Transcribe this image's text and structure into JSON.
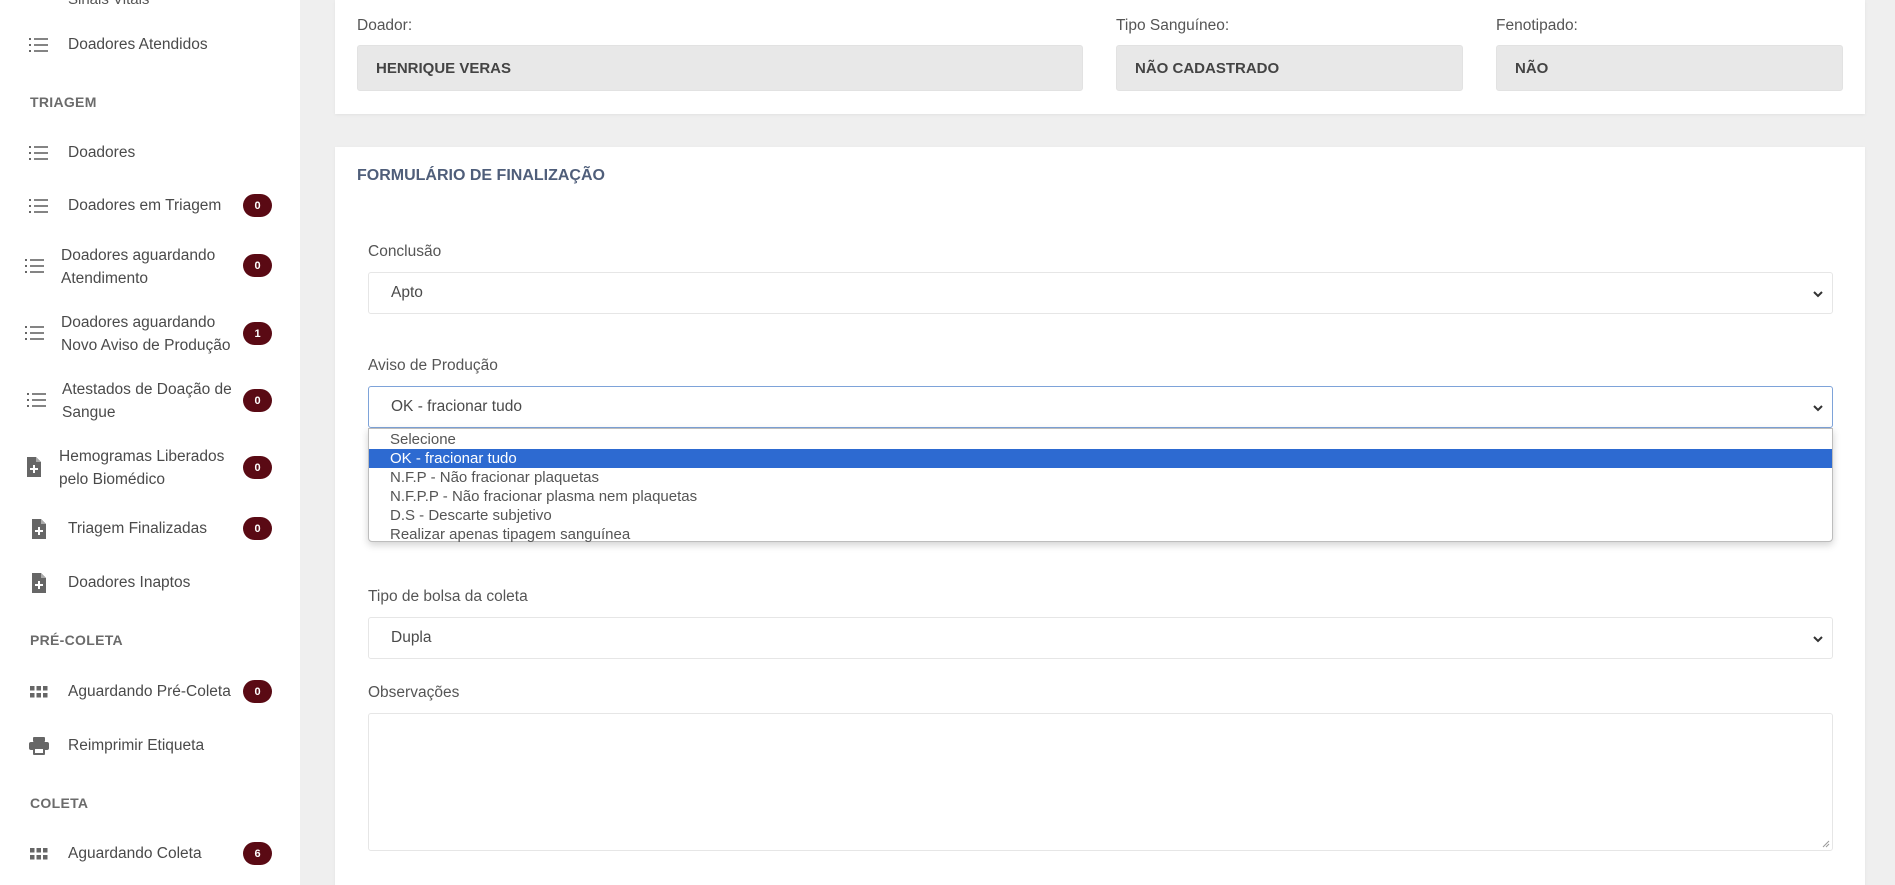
{
  "sidebar": {
    "cut_item": "Sinais Vitais",
    "sections": {
      "triagem": "TRIAGEM",
      "pre_coleta": "PRÉ-COLETA",
      "coleta": "COLETA"
    },
    "items": {
      "doadores_atendidos": {
        "label": "Doadores Atendidos",
        "icon": "list-icon"
      },
      "doadores": {
        "label": "Doadores",
        "icon": "list-icon"
      },
      "doadores_em_triagem": {
        "label": "Doadores em Triagem",
        "badge": "0",
        "icon": "list-icon"
      },
      "aguardando_atendimento": {
        "label1": "Doadores aguardando",
        "label2": "Atendimento",
        "badge": "0",
        "icon": "list-icon"
      },
      "aguardando_aviso": {
        "label1": "Doadores aguardando",
        "label2": "Novo Aviso de Produção",
        "badge": "1",
        "icon": "list-icon"
      },
      "atestados": {
        "label1": "Atestados de Doação de",
        "label2": "Sangue",
        "badge": "0",
        "icon": "list-icon"
      },
      "hemogramas": {
        "label1": "Hemogramas Liberados",
        "label2": "pelo Biomédico",
        "badge": "0",
        "icon": "file-plus-icon"
      },
      "triagem_finalizadas": {
        "label": "Triagem Finalizadas",
        "badge": "0",
        "icon": "file-plus-icon"
      },
      "doadores_inaptos": {
        "label": "Doadores Inaptos",
        "icon": "file-plus-icon"
      },
      "aguardando_pre_coleta": {
        "label": "Aguardando Pré-Coleta",
        "badge": "0",
        "icon": "grid-icon"
      },
      "reimprimir_etiqueta": {
        "label": "Reimprimir Etiqueta",
        "icon": "printer-icon"
      },
      "aguardando_coleta": {
        "label": "Aguardando Coleta",
        "badge": "6",
        "icon": "grid-icon"
      }
    },
    "badge_color": "#5a0a14"
  },
  "donor": {
    "doador_label": "Doador:",
    "doador_value": "HENRIQUE VERAS",
    "tipo_label": "Tipo Sanguíneo:",
    "tipo_value": "NÃO CADASTRADO",
    "fenotipado_label": "Fenotipado:",
    "fenotipado_value": "NÃO"
  },
  "form": {
    "title": "FORMULÁRIO DE FINALIZAÇÃO",
    "conclusao_label": "Conclusão",
    "conclusao_value": "Apto",
    "aviso_label": "Aviso de Produção",
    "aviso_value": "OK - fracionar tudo",
    "aviso_options": [
      "Selecione",
      "OK - fracionar tudo",
      "N.F.P - Não fracionar plaquetas",
      "N.F.P.P - Não fracionar plasma nem plaquetas",
      "D.S - Descarte subjetivo",
      "Realizar apenas tipagem sanguínea"
    ],
    "aviso_selected_index": 1,
    "bolsa_label": "Tipo de bolsa da coleta",
    "bolsa_value": "Dupla",
    "observacoes_label": "Observações",
    "observacoes_value": ""
  },
  "colors": {
    "accent": "#2d6ad1",
    "title": "#4f5e7a"
  }
}
